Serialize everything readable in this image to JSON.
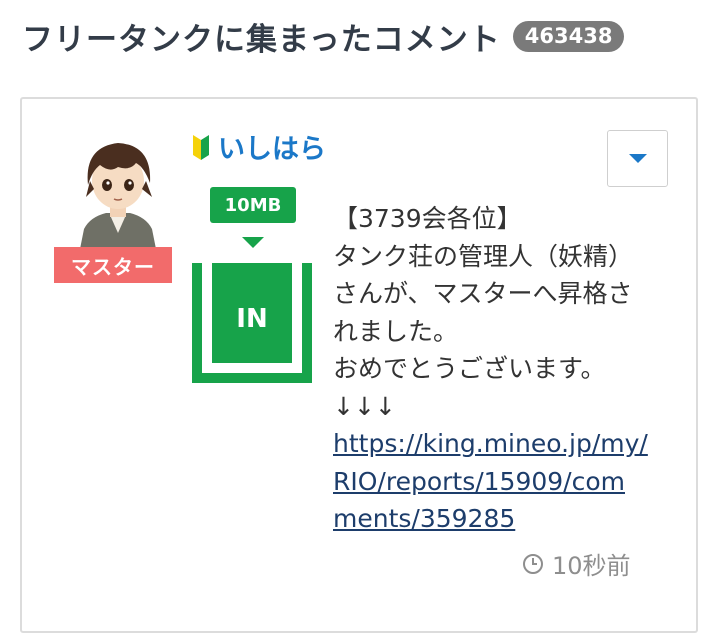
{
  "header": {
    "title": "フリータンクに集まったコメント",
    "count": "463438"
  },
  "comment": {
    "user": {
      "name": "いしはら",
      "rank": "マスター",
      "beginner_icon": "beginner-mark-icon",
      "avatar": "user-avatar"
    },
    "tank_action": {
      "amount": "10MB",
      "direction": "IN"
    },
    "body_lines": [
      "【3739会各位】",
      "タンク荘の管理人（妖精）さんが、マスターへ昇格されました。",
      "おめでとうございます。",
      "↓↓↓"
    ],
    "link": "https://king.mineo.jp/my/RIO/reports/15909/comments/359285",
    "timestamp": "10秒前",
    "menu_icon": "chevron-down-icon"
  },
  "colors": {
    "accent_blue": "#1b78c8",
    "tank_green": "#17a34a",
    "rank_red": "#f26b6b",
    "badge_gray": "#7a7a7a"
  }
}
